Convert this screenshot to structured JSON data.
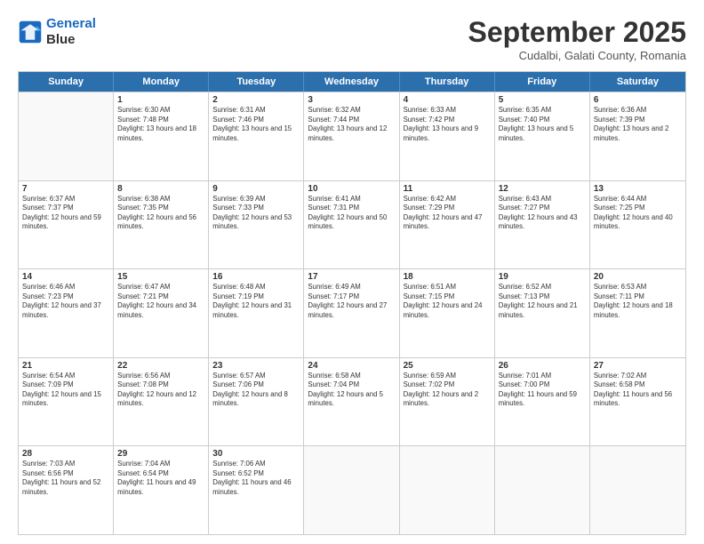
{
  "logo": {
    "line1": "General",
    "line2": "Blue"
  },
  "title": "September 2025",
  "subtitle": "Cudalbi, Galati County, Romania",
  "days_of_week": [
    "Sunday",
    "Monday",
    "Tuesday",
    "Wednesday",
    "Thursday",
    "Friday",
    "Saturday"
  ],
  "weeks": [
    [
      {
        "day": "",
        "empty": true
      },
      {
        "day": "1",
        "sunrise": "6:30 AM",
        "sunset": "7:48 PM",
        "daylight": "13 hours and 18 minutes."
      },
      {
        "day": "2",
        "sunrise": "6:31 AM",
        "sunset": "7:46 PM",
        "daylight": "13 hours and 15 minutes."
      },
      {
        "day": "3",
        "sunrise": "6:32 AM",
        "sunset": "7:44 PM",
        "daylight": "13 hours and 12 minutes."
      },
      {
        "day": "4",
        "sunrise": "6:33 AM",
        "sunset": "7:42 PM",
        "daylight": "13 hours and 9 minutes."
      },
      {
        "day": "5",
        "sunrise": "6:35 AM",
        "sunset": "7:40 PM",
        "daylight": "13 hours and 5 minutes."
      },
      {
        "day": "6",
        "sunrise": "6:36 AM",
        "sunset": "7:39 PM",
        "daylight": "13 hours and 2 minutes."
      }
    ],
    [
      {
        "day": "7",
        "sunrise": "6:37 AM",
        "sunset": "7:37 PM",
        "daylight": "12 hours and 59 minutes."
      },
      {
        "day": "8",
        "sunrise": "6:38 AM",
        "sunset": "7:35 PM",
        "daylight": "12 hours and 56 minutes."
      },
      {
        "day": "9",
        "sunrise": "6:39 AM",
        "sunset": "7:33 PM",
        "daylight": "12 hours and 53 minutes."
      },
      {
        "day": "10",
        "sunrise": "6:41 AM",
        "sunset": "7:31 PM",
        "daylight": "12 hours and 50 minutes."
      },
      {
        "day": "11",
        "sunrise": "6:42 AM",
        "sunset": "7:29 PM",
        "daylight": "12 hours and 47 minutes."
      },
      {
        "day": "12",
        "sunrise": "6:43 AM",
        "sunset": "7:27 PM",
        "daylight": "12 hours and 43 minutes."
      },
      {
        "day": "13",
        "sunrise": "6:44 AM",
        "sunset": "7:25 PM",
        "daylight": "12 hours and 40 minutes."
      }
    ],
    [
      {
        "day": "14",
        "sunrise": "6:46 AM",
        "sunset": "7:23 PM",
        "daylight": "12 hours and 37 minutes."
      },
      {
        "day": "15",
        "sunrise": "6:47 AM",
        "sunset": "7:21 PM",
        "daylight": "12 hours and 34 minutes."
      },
      {
        "day": "16",
        "sunrise": "6:48 AM",
        "sunset": "7:19 PM",
        "daylight": "12 hours and 31 minutes."
      },
      {
        "day": "17",
        "sunrise": "6:49 AM",
        "sunset": "7:17 PM",
        "daylight": "12 hours and 27 minutes."
      },
      {
        "day": "18",
        "sunrise": "6:51 AM",
        "sunset": "7:15 PM",
        "daylight": "12 hours and 24 minutes."
      },
      {
        "day": "19",
        "sunrise": "6:52 AM",
        "sunset": "7:13 PM",
        "daylight": "12 hours and 21 minutes."
      },
      {
        "day": "20",
        "sunrise": "6:53 AM",
        "sunset": "7:11 PM",
        "daylight": "12 hours and 18 minutes."
      }
    ],
    [
      {
        "day": "21",
        "sunrise": "6:54 AM",
        "sunset": "7:09 PM",
        "daylight": "12 hours and 15 minutes."
      },
      {
        "day": "22",
        "sunrise": "6:56 AM",
        "sunset": "7:08 PM",
        "daylight": "12 hours and 12 minutes."
      },
      {
        "day": "23",
        "sunrise": "6:57 AM",
        "sunset": "7:06 PM",
        "daylight": "12 hours and 8 minutes."
      },
      {
        "day": "24",
        "sunrise": "6:58 AM",
        "sunset": "7:04 PM",
        "daylight": "12 hours and 5 minutes."
      },
      {
        "day": "25",
        "sunrise": "6:59 AM",
        "sunset": "7:02 PM",
        "daylight": "12 hours and 2 minutes."
      },
      {
        "day": "26",
        "sunrise": "7:01 AM",
        "sunset": "7:00 PM",
        "daylight": "11 hours and 59 minutes."
      },
      {
        "day": "27",
        "sunrise": "7:02 AM",
        "sunset": "6:58 PM",
        "daylight": "11 hours and 56 minutes."
      }
    ],
    [
      {
        "day": "28",
        "sunrise": "7:03 AM",
        "sunset": "6:56 PM",
        "daylight": "11 hours and 52 minutes."
      },
      {
        "day": "29",
        "sunrise": "7:04 AM",
        "sunset": "6:54 PM",
        "daylight": "11 hours and 49 minutes."
      },
      {
        "day": "30",
        "sunrise": "7:06 AM",
        "sunset": "6:52 PM",
        "daylight": "11 hours and 46 minutes."
      },
      {
        "day": "",
        "empty": true
      },
      {
        "day": "",
        "empty": true
      },
      {
        "day": "",
        "empty": true
      },
      {
        "day": "",
        "empty": true
      }
    ]
  ],
  "labels": {
    "sunrise": "Sunrise:",
    "sunset": "Sunset:",
    "daylight": "Daylight:"
  }
}
